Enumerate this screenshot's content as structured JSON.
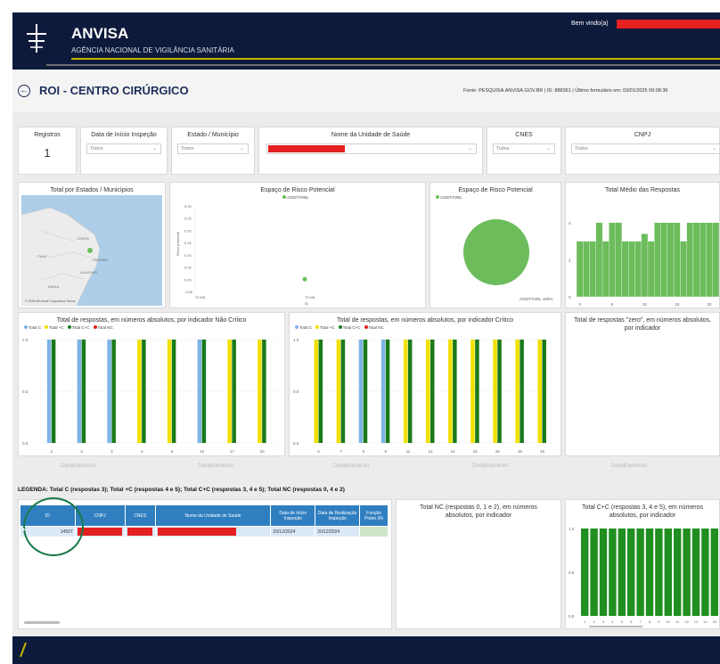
{
  "header": {
    "app_name": "ANVISA",
    "subtitle": "AGÊNCIA NACIONAL DE VIGILÂNCIA SANITÁRIA",
    "welcome": "Bem vindo(a)"
  },
  "page": {
    "back_icon": "back-arrow-icon",
    "title": "ROI - CENTRO CIRÚRGICO",
    "source": "Fonte: PESQUISA.ANVISA.GOV.BR | ID: 888361 | Último formulário em: 03/01/2025 09:08:36"
  },
  "filters": {
    "registros_label": "Registros",
    "registros_value": "1",
    "data_label": "Data de Início Inspeção",
    "data_value": "Todos",
    "estado_label": "Estado / Município",
    "estado_value": "Todos",
    "unidade_label": "Nome da Unidade de Saúde",
    "cnes_label": "CNES",
    "cnes_value": "Todos",
    "cnpj_label": "CNPJ",
    "cnpj_value": "Todos"
  },
  "map": {
    "title": "Total por Estados / Municípios",
    "place_labels": [
      "CEARÁ",
      "PARAÍBA",
      "ALAGOAS",
      "PIAUÍ",
      "BAHIA"
    ],
    "attribution": "© 2025 Microsoft Corporation  Terms"
  },
  "risk_scatter": {
    "title": "Espaço de Risco Potencial",
    "legend": "ACEITÁVEL",
    "y_ticks": [
      "0.30",
      "0.25",
      "0.20",
      "0.15",
      "0.10",
      "0.05",
      "0.00",
      "-0.05"
    ],
    "x_ticks": [
      "70 MIL",
      "75 MIL"
    ],
    "ylabel": "Risco potencial",
    "xlabel": "ID"
  },
  "risk_pie": {
    "title": "Espaço de Risco Potencial",
    "legend": "ACEITÁVEL",
    "slice_label": "ACEITÁVEL 100%"
  },
  "avg_chart": {
    "title": "Total Médio das Respostas",
    "y_ticks": [
      "4",
      "2",
      "0"
    ],
    "x_ticks": [
      "0",
      "5",
      "10",
      "15",
      "20"
    ]
  },
  "noncritical": {
    "title": "Total de respostas, em números absolutos, por indicador Não Crítico",
    "legend": [
      "Total C",
      "Total +C",
      "Total C+C",
      "Total NC"
    ],
    "y_ticks": [
      "1.0",
      "0.5",
      "0.0"
    ],
    "x_ticks": [
      "1",
      "2",
      "3",
      "4",
      "5",
      "10",
      "17",
      "20"
    ]
  },
  "critical": {
    "title": "Total de respostas, em números absolutos, por indicador Crítico",
    "legend": [
      "Total C",
      "Total +C",
      "Total C+C",
      "Total NC"
    ],
    "y_ticks": [
      "1.0",
      "0.5",
      "0.0"
    ],
    "x_ticks": [
      "6",
      "7",
      "8",
      "9",
      "11",
      "12",
      "14",
      "15",
      "16",
      "18",
      "19"
    ]
  },
  "zero": {
    "title": "Total de respostas \"zero\", em números absolutos, por indicador"
  },
  "detail_labels": [
    "Detalhamento",
    "Detalhamento",
    "Detalhamento",
    "Detalhamento",
    "Detalhamento"
  ],
  "legend_text": "LEGENDA: Total C (respostas 3); Total +C (respostas 4 e 5); Total C+C (respostas 3, 4 e 5); Total NC (respostas 0, 4 e 2)",
  "table": {
    "headers": [
      "ID",
      "CNPJ",
      "CNES",
      "Nome da Unidade de Saúde",
      "Data de Início Inspeção",
      "Data de Realização Inspeção",
      "Função Poten (Ri"
    ],
    "row": {
      "id": "14507",
      "data_inicio": "20/12/2024",
      "data_realizacao": "20/12/2024"
    }
  },
  "nc_panel": {
    "title": "Total NC (respostas 0, 1 e 2), em números absolutos, por indicador"
  },
  "cc_chart": {
    "title": "Total C+C (respostas 3, 4 e 5), em números absolutos, por indicador",
    "y_ticks": [
      "1.0",
      "0.5",
      "0.0"
    ],
    "x_ticks": [
      "1",
      "2",
      "3",
      "4",
      "5",
      "6",
      "7",
      "8",
      "9",
      "10",
      "11",
      "12",
      "13",
      "14",
      "15"
    ]
  },
  "colors": {
    "navy": "#0e1a3c",
    "gold": "#c8b400",
    "totalC": "#7fb3e6",
    "totalPlusC": "#f0e000",
    "totalCC": "#1a7a1a",
    "totalNC": "#e42020",
    "green": "#6cbc5c"
  },
  "chart_data": [
    {
      "type": "bar",
      "title": "Total Médio das Respostas",
      "x": [
        0,
        1,
        2,
        3,
        4,
        5,
        6,
        7,
        8,
        9,
        10,
        11,
        12,
        13,
        14,
        15,
        16,
        17,
        18,
        19,
        20,
        21
      ],
      "values": [
        3,
        3,
        3,
        4,
        3,
        4,
        4,
        3,
        3,
        3,
        3.4,
        3,
        4,
        4,
        4,
        4,
        3,
        4,
        4,
        4,
        4,
        4
      ],
      "ylim": [
        0,
        5
      ]
    },
    {
      "type": "bar",
      "title": "Total de respostas, em números absolutos, por indicador Não Crítico",
      "categories": [
        "1",
        "2",
        "3",
        "4",
        "5",
        "10",
        "17",
        "20"
      ],
      "series": [
        {
          "name": "Total C",
          "values": [
            1,
            1,
            1,
            0,
            0,
            1,
            0,
            0
          ]
        },
        {
          "name": "Total +C",
          "values": [
            0,
            0,
            0,
            1,
            1,
            0,
            1,
            1
          ]
        },
        {
          "name": "Total C+C",
          "values": [
            1,
            1,
            1,
            1,
            1,
            1,
            1,
            1
          ]
        },
        {
          "name": "Total NC",
          "values": [
            0,
            0,
            0,
            0,
            0,
            0,
            0,
            0
          ]
        }
      ],
      "ylim": [
        0,
        1
      ]
    },
    {
      "type": "bar",
      "title": "Total de respostas, em números absolutos, por indicador Crítico",
      "categories": [
        "6",
        "7",
        "8",
        "9",
        "11",
        "12",
        "14",
        "15",
        "16",
        "18",
        "19"
      ],
      "series": [
        {
          "name": "Total C",
          "values": [
            0,
            0,
            1,
            1,
            0,
            0,
            0,
            0,
            0,
            0,
            0
          ]
        },
        {
          "name": "Total +C",
          "values": [
            1,
            1,
            0,
            0,
            1,
            1,
            1,
            1,
            1,
            1,
            1
          ]
        },
        {
          "name": "Total C+C",
          "values": [
            1,
            1,
            1,
            1,
            1,
            1,
            1,
            1,
            1,
            1,
            1
          ]
        },
        {
          "name": "Total NC",
          "values": [
            0,
            0,
            0,
            0,
            0,
            0,
            0,
            0,
            0,
            0,
            0
          ]
        }
      ],
      "ylim": [
        0,
        1
      ]
    },
    {
      "type": "bar",
      "title": "Total C+C (respostas 3, 4 e 5), em números absolutos, por indicador",
      "categories": [
        "1",
        "2",
        "3",
        "4",
        "5",
        "6",
        "7",
        "8",
        "9",
        "10",
        "11",
        "12",
        "13",
        "14",
        "15"
      ],
      "values": [
        1,
        1,
        1,
        1,
        1,
        1,
        1,
        1,
        1,
        1,
        1,
        1,
        1,
        1,
        1
      ],
      "ylim": [
        0,
        1
      ]
    },
    {
      "type": "pie",
      "title": "Espaço de Risco Potencial",
      "categories": [
        "ACEITÁVEL"
      ],
      "values": [
        100
      ]
    },
    {
      "type": "scatter",
      "title": "Espaço de Risco Potencial",
      "x": [
        75000
      ],
      "y": [
        0.0
      ],
      "ylim": [
        -0.05,
        0.3
      ]
    }
  ]
}
